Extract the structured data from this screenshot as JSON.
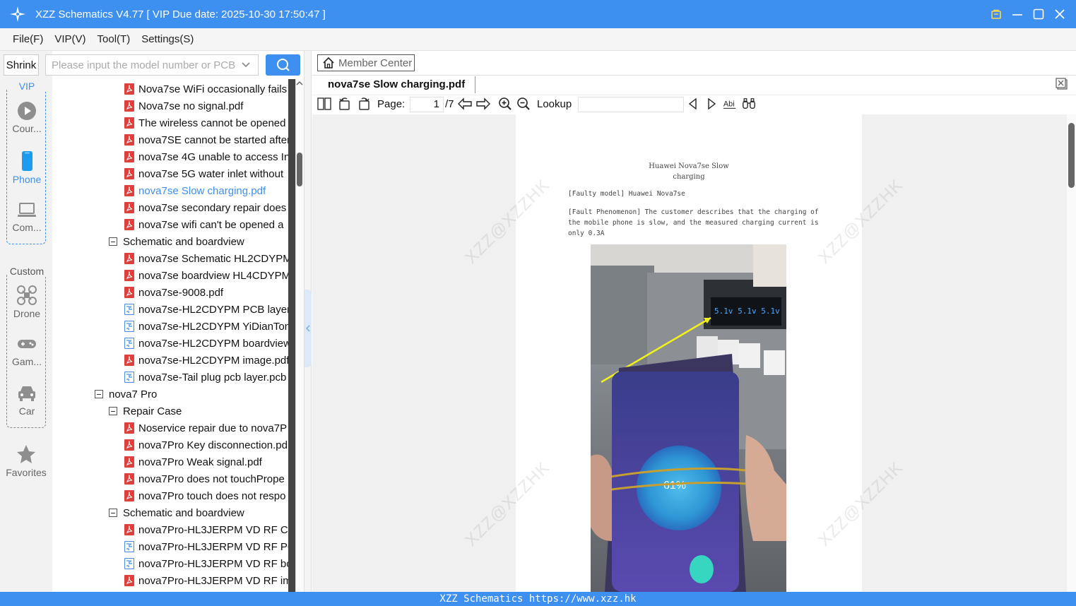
{
  "window": {
    "title": "XZZ Schematics V4.77 [ VIP Due date: 2025-10-30 17:50:47 ]"
  },
  "menu": [
    "File(F)",
    "VIP(V)",
    "Tool(T)",
    "Settings(S)"
  ],
  "sidebar": {
    "shrink_label": "Shrink",
    "vip_label": "VIP",
    "custom_label": "Custom",
    "items": [
      {
        "label": "Cour...",
        "icon": "play-circle-icon"
      },
      {
        "label": "Phone",
        "icon": "phone-icon",
        "active": true
      },
      {
        "label": "Com...",
        "icon": "laptop-icon"
      },
      {
        "label": "Drone",
        "icon": "drone-icon"
      },
      {
        "label": "Gam...",
        "icon": "gamepad-icon"
      },
      {
        "label": "Car",
        "icon": "car-icon"
      },
      {
        "label": "Favorites",
        "icon": "star-icon"
      }
    ]
  },
  "search": {
    "placeholder": "Please input the model number or PCB"
  },
  "tree": [
    {
      "label": "Nova7se WiFi occasionally fails",
      "type": "pdf",
      "level": 3
    },
    {
      "label": "Nova7se no signal.pdf",
      "type": "pdf",
      "level": 3
    },
    {
      "label": "The wireless cannot be opened",
      "type": "pdf",
      "level": 3
    },
    {
      "label": "nova7SE cannot be started after",
      "type": "pdf",
      "level": 3
    },
    {
      "label": "nova7se 4G unable to access Int",
      "type": "pdf",
      "level": 3
    },
    {
      "label": "nova7se 5G water inlet without",
      "type": "pdf",
      "level": 3
    },
    {
      "label": "nova7se Slow charging.pdf",
      "type": "pdf",
      "level": 3,
      "selected": true
    },
    {
      "label": "nova7se secondary repair does",
      "type": "pdf",
      "level": 3
    },
    {
      "label": "nova7se wifi can't be opened a",
      "type": "pdf",
      "level": 3
    },
    {
      "label": "Schematic and boardview",
      "type": "folder",
      "level": 2
    },
    {
      "label": "nova7se Schematic HL2CDYPM.",
      "type": "pdf",
      "level": 3
    },
    {
      "label": "nova7se boardview HL4CDYPM",
      "type": "pdf",
      "level": 3
    },
    {
      "label": "nova7se-9008.pdf",
      "type": "pdf",
      "level": 3
    },
    {
      "label": "nova7se-HL2CDYPM PCB layer.p",
      "type": "pcb",
      "level": 3
    },
    {
      "label": "nova7se-HL2CDYPM YiDianTon",
      "type": "pcb",
      "level": 3
    },
    {
      "label": "nova7se-HL2CDYPM boardview",
      "type": "pcb",
      "level": 3
    },
    {
      "label": "nova7se-HL2CDYPM image.pdf",
      "type": "pdf",
      "level": 3
    },
    {
      "label": "nova7se-Tail plug pcb layer.pcb",
      "type": "pcb",
      "level": 3
    },
    {
      "label": "nova7 Pro",
      "type": "folder",
      "level": 1
    },
    {
      "label": "Repair Case",
      "type": "folder",
      "level": 2
    },
    {
      "label": "Noservice repair due to nova7P",
      "type": "pdf",
      "level": 3
    },
    {
      "label": "nova7Pro Key disconnection.pd",
      "type": "pdf",
      "level": 3
    },
    {
      "label": "nova7Pro Weak signal.pdf",
      "type": "pdf",
      "level": 3
    },
    {
      "label": "nova7Pro does not touchPrope",
      "type": "pdf",
      "level": 3
    },
    {
      "label": "nova7Pro touch does not respo",
      "type": "pdf",
      "level": 3
    },
    {
      "label": "Schematic and boardview",
      "type": "folder",
      "level": 2
    },
    {
      "label": "nova7Pro-HL3JERPM VD RF Cor",
      "type": "pdf",
      "level": 3
    },
    {
      "label": "nova7Pro-HL3JERPM VD RF PCI",
      "type": "pcb",
      "level": 3
    },
    {
      "label": "nova7Pro-HL3JERPM VD RF boa",
      "type": "pcb",
      "level": 3
    },
    {
      "label": "nova7Pro-HL3JERPM VD RF ima",
      "type": "pdf",
      "level": 3
    }
  ],
  "member_center": "Member Center",
  "doc_tab": "nova7se Slow charging.pdf",
  "toolbar": {
    "page_label": "Page:",
    "page_value": "1",
    "page_total": "/7",
    "lookup_label": "Lookup"
  },
  "document": {
    "title_line1": "Huawei Nova7se Slow",
    "title_line2": "charging",
    "faulty_model": "[Faulty model] Huawei Nova7se",
    "phenomenon": "[Fault Phenomenon] The customer describes that the charging of\nthe mobile phone is slow, and the measured charging current is\nonly 0.3A",
    "watermark": "XZZ@XZZHK",
    "photo_reading": "61%"
  },
  "status": "XZZ Schematics https://www.xzz.hk",
  "colors": {
    "accent": "#3d8ff0",
    "pdf_icon": "#e0403a",
    "pcb_icon": "#4a8fe0"
  }
}
